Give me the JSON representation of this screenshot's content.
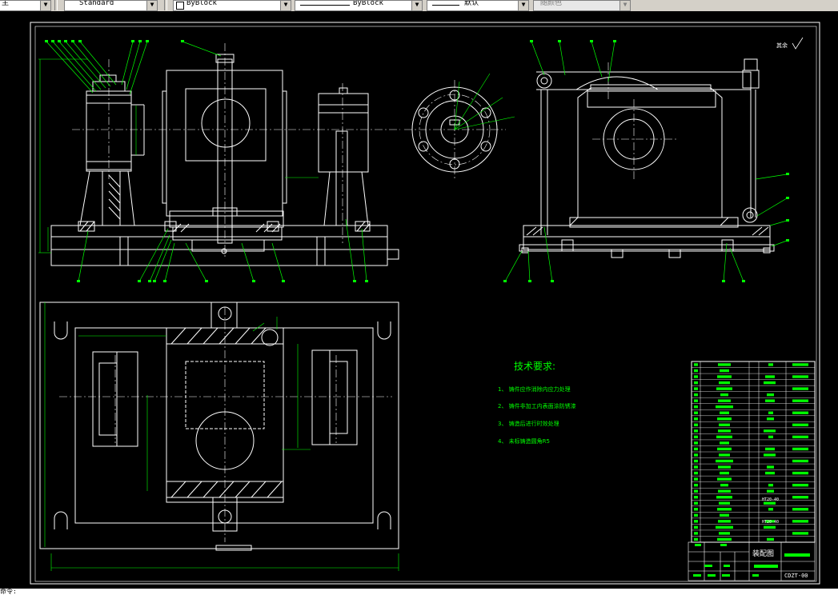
{
  "toolbar": {
    "layer_combo_value": "主",
    "text_style_value": "Standard",
    "linetype_value": "ByBlock",
    "lineweight_value": "ByBlock",
    "plot_style_value": "默认",
    "color_value": "随颜色"
  },
  "drawing": {
    "technical_requirements": {
      "title": "技术要求:",
      "items": [
        "1、  铸件应作消除内应力处理",
        "2、  铸件非加工内表面涂防锈漆",
        "3、  铸造后进行时效处理",
        "4、  未标铸造圆角R5"
      ]
    },
    "roughness_note": "其余",
    "title_block": {
      "drawing_name": "装配图",
      "drawing_code": "CDZT-00",
      "material_codes": [
        "HT20-40",
        "HT20-40"
      ]
    }
  },
  "colors": {
    "background": "#000000",
    "outline": "#ffffff",
    "centerline": "#ffffff",
    "leader": "#00ff00",
    "dimension": "#00ff00"
  },
  "cmdline": {
    "text": "命令:"
  }
}
